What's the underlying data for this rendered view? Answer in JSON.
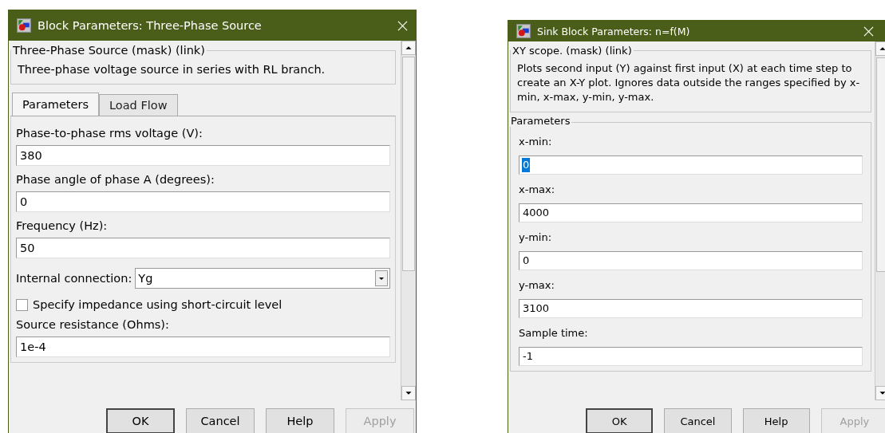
{
  "dialogs": [
    {
      "title": "Block Parameters: Three-Phase Source",
      "mask": {
        "legend": "Three-Phase Source (mask) (link)",
        "description": "Three-phase voltage source in series with RL branch."
      },
      "tabs": [
        {
          "label": "Parameters",
          "selected": true
        },
        {
          "label": "Load Flow",
          "selected": false
        }
      ],
      "fields": [
        {
          "kind": "text",
          "label": "Phase-to-phase rms voltage (V):",
          "value": "380",
          "text_selected": false
        },
        {
          "kind": "text",
          "label": "Phase angle of phase A (degrees):",
          "value": "0",
          "text_selected": false
        },
        {
          "kind": "text",
          "label": "Frequency (Hz):",
          "value": "50",
          "text_selected": false
        },
        {
          "kind": "dropdown",
          "label": "Internal connection:",
          "value": "Yg"
        },
        {
          "kind": "checkbox",
          "label": "Specify impedance using short-circuit level",
          "checked": false
        },
        {
          "kind": "text",
          "label": "Source resistance (Ohms):",
          "value": "1e-4",
          "text_selected": false
        }
      ],
      "buttons": [
        {
          "label": "OK",
          "disabled": false
        },
        {
          "label": "Cancel",
          "disabled": false
        },
        {
          "label": "Help",
          "disabled": false
        },
        {
          "label": "Apply",
          "disabled": true
        }
      ]
    },
    {
      "title": "Sink Block Parameters: n=f(M)",
      "mask": {
        "legend": "XY scope. (mask) (link)",
        "description": "Plots second input (Y) against first input (X) at each time step to  create an X-Y plot. Ignores data outside the ranges specified by x-min, x-max, y-min, y-max."
      },
      "parameters_legend": "Parameters",
      "fields": [
        {
          "kind": "text",
          "label": "x-min:",
          "value": "0",
          "text_selected": true
        },
        {
          "kind": "text",
          "label": "x-max:",
          "value": "4000",
          "text_selected": false
        },
        {
          "kind": "text",
          "label": "y-min:",
          "value": "0",
          "text_selected": false
        },
        {
          "kind": "text",
          "label": "y-max:",
          "value": "3100",
          "text_selected": false
        },
        {
          "kind": "text",
          "label": "Sample time:",
          "value": "-1",
          "text_selected": false
        }
      ],
      "buttons": [
        {
          "label": "OK",
          "disabled": false
        },
        {
          "label": "Cancel",
          "disabled": false
        },
        {
          "label": "Help",
          "disabled": false
        },
        {
          "label": "Apply",
          "disabled": true
        }
      ]
    }
  ]
}
